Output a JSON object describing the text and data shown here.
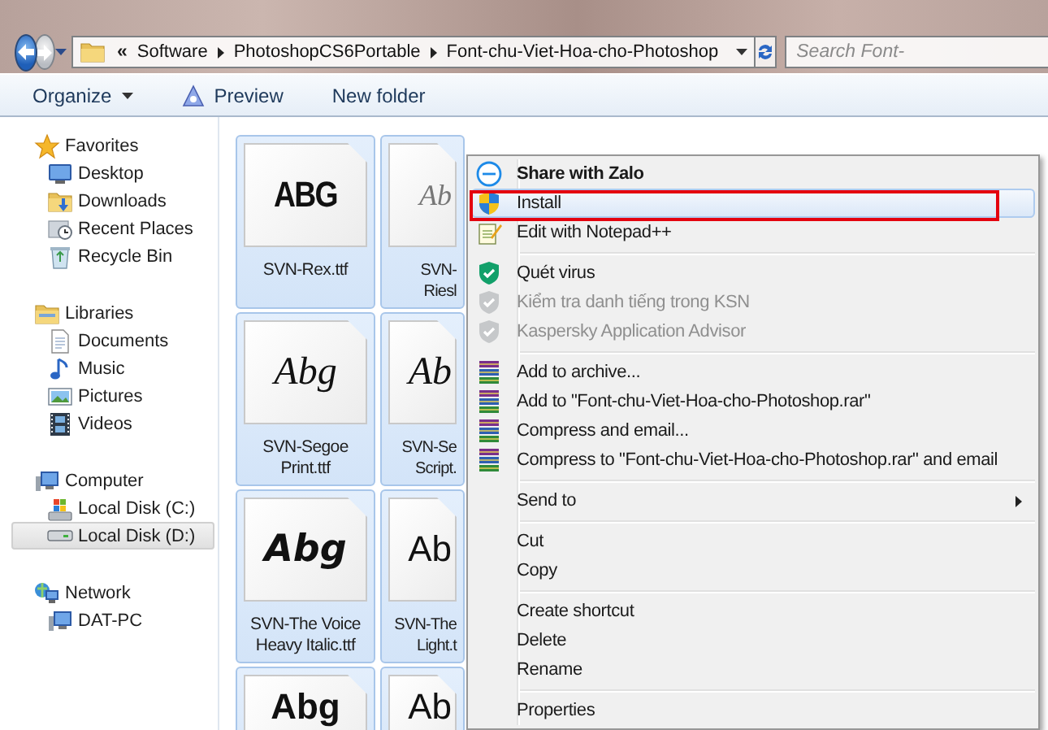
{
  "address_bar": {
    "overflow": "«",
    "crumbs": [
      "Software",
      "PhotoshopCS6Portable",
      "Font-chu-Viet-Hoa-cho-Photoshop"
    ],
    "search": {
      "placeholder": "Search Font-"
    }
  },
  "toolbar": [
    {
      "label": "Organize",
      "kind": "dropdown"
    },
    {
      "label": "Preview",
      "kind": "with_icon"
    },
    {
      "label": "New folder",
      "kind": "plain"
    }
  ],
  "nav": [
    {
      "label": "Favorites",
      "selected": false,
      "children": [
        {
          "label": "Desktop",
          "selected": false
        },
        {
          "label": "Downloads",
          "selected": false
        },
        {
          "label": "Recent Places",
          "selected": false
        },
        {
          "label": "Recycle Bin",
          "selected": false
        }
      ]
    },
    {
      "label": "Libraries",
      "selected": false,
      "children": [
        {
          "label": "Documents",
          "selected": false
        },
        {
          "label": "Music",
          "selected": false
        },
        {
          "label": "Pictures",
          "selected": false
        },
        {
          "label": "Videos",
          "selected": false
        }
      ]
    },
    {
      "label": "Computer",
      "selected": false,
      "children": [
        {
          "label": "Local Disk (C:)",
          "selected": false
        },
        {
          "label": "Local Disk (D:)",
          "selected": true
        }
      ]
    },
    {
      "label": "Network",
      "selected": false,
      "children": [
        {
          "label": "DAT-PC",
          "selected": false
        }
      ]
    }
  ],
  "files": [
    {
      "label": "SVN-Rex.ttf",
      "preview": "ABG",
      "selected": true
    },
    {
      "label": "SVN-Riesl",
      "preview": "Ab",
      "selected": true
    },
    {
      "label": "SVN-Segoe Print.ttf",
      "preview": "Abg",
      "selected": true
    },
    {
      "label": "SVN-Se Script.",
      "preview": "Ab",
      "selected": true
    },
    {
      "label": "SVN-The Voice Heavy Italic.ttf",
      "preview": "Abg",
      "selected": true
    },
    {
      "label": "SVN-The Light.t",
      "preview": "Ab",
      "selected": true
    },
    {
      "preview": "Abg",
      "selected": true
    },
    {
      "preview": "Ab",
      "selected": true
    }
  ],
  "context_menu": [
    {
      "kind": "item",
      "label": "Share with Zalo",
      "bold": true,
      "disabled": false,
      "selected": false,
      "outlined": false,
      "submenu": false
    },
    {
      "kind": "item",
      "label": "Install",
      "bold": false,
      "disabled": false,
      "selected": true,
      "outlined": true,
      "submenu": false
    },
    {
      "kind": "item",
      "label": "Edit with Notepad++",
      "bold": false,
      "disabled": false,
      "selected": false,
      "outlined": false,
      "submenu": false
    },
    {
      "kind": "separator"
    },
    {
      "kind": "item",
      "label": "Quét virus",
      "bold": false,
      "disabled": false,
      "selected": false,
      "outlined": false,
      "submenu": false
    },
    {
      "kind": "item",
      "label": "Kiểm tra danh tiếng trong KSN",
      "bold": false,
      "disabled": true,
      "selected": false,
      "outlined": false,
      "submenu": false
    },
    {
      "kind": "item",
      "label": "Kaspersky Application Advisor",
      "bold": false,
      "disabled": true,
      "selected": false,
      "outlined": false,
      "submenu": false
    },
    {
      "kind": "separator"
    },
    {
      "kind": "item",
      "label": "Add to archive...",
      "bold": false,
      "disabled": false,
      "selected": false,
      "outlined": false,
      "submenu": false
    },
    {
      "kind": "item",
      "label": "Add to \"Font-chu-Viet-Hoa-cho-Photoshop.rar\"",
      "bold": false,
      "disabled": false,
      "selected": false,
      "outlined": false,
      "submenu": false
    },
    {
      "kind": "item",
      "label": "Compress and email...",
      "bold": false,
      "disabled": false,
      "selected": false,
      "outlined": false,
      "submenu": false
    },
    {
      "kind": "item",
      "label": "Compress to \"Font-chu-Viet-Hoa-cho-Photoshop.rar\" and email",
      "bold": false,
      "disabled": false,
      "selected": false,
      "outlined": false,
      "submenu": false
    },
    {
      "kind": "separator"
    },
    {
      "kind": "item",
      "label": "Send to",
      "bold": false,
      "disabled": false,
      "selected": false,
      "outlined": false,
      "submenu": true
    },
    {
      "kind": "separator"
    },
    {
      "kind": "item",
      "label": "Cut",
      "bold": false,
      "disabled": false,
      "selected": false,
      "outlined": false,
      "submenu": false
    },
    {
      "kind": "item",
      "label": "Copy",
      "bold": false,
      "disabled": false,
      "selected": false,
      "outlined": false,
      "submenu": false
    },
    {
      "kind": "separator"
    },
    {
      "kind": "item",
      "label": "Create shortcut",
      "bold": false,
      "disabled": false,
      "selected": false,
      "outlined": false,
      "submenu": false
    },
    {
      "kind": "item",
      "label": "Delete",
      "bold": false,
      "disabled": false,
      "selected": false,
      "outlined": false,
      "submenu": false
    },
    {
      "kind": "item",
      "label": "Rename",
      "bold": false,
      "disabled": false,
      "selected": false,
      "outlined": false,
      "submenu": false
    },
    {
      "kind": "separator"
    },
    {
      "kind": "item",
      "label": "Properties",
      "bold": false,
      "disabled": false,
      "selected": false,
      "outlined": false,
      "submenu": false
    }
  ]
}
